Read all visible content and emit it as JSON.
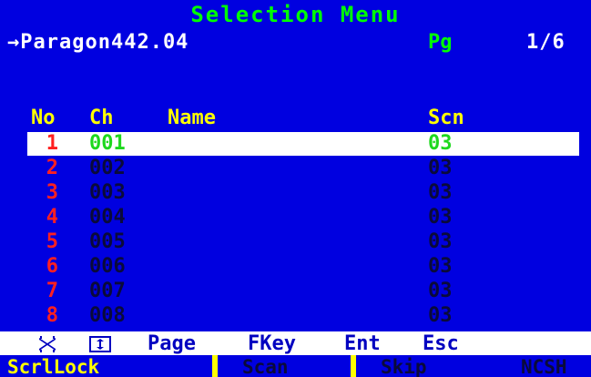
{
  "title": "Selection Menu",
  "current_path": "→Paragon442.04",
  "page": {
    "label": "Pg",
    "value": "1/6"
  },
  "headers": {
    "no": "No",
    "ch": "Ch",
    "name": "Name",
    "scn": "Scn"
  },
  "rows": [
    {
      "no": "1",
      "ch": "001",
      "name": "",
      "scn": "03",
      "selected": true
    },
    {
      "no": "2",
      "ch": "002",
      "name": "",
      "scn": "03"
    },
    {
      "no": "3",
      "ch": "003",
      "name": "",
      "scn": "03"
    },
    {
      "no": "4",
      "ch": "004",
      "name": "",
      "scn": "03"
    },
    {
      "no": "5",
      "ch": "005",
      "name": "",
      "scn": "03"
    },
    {
      "no": "6",
      "ch": "006",
      "name": "",
      "scn": "03"
    },
    {
      "no": "7",
      "ch": "007",
      "name": "",
      "scn": "03"
    },
    {
      "no": "8",
      "ch": "008",
      "name": "",
      "scn": "03"
    }
  ],
  "keybar": {
    "page": "Page",
    "fkey": "FKey",
    "ent": "Ent",
    "esc": "Esc"
  },
  "status": {
    "scrllock": "ScrlLock",
    "scan": "Scan",
    "skip": "Skip",
    "ncsh": "NCSH"
  },
  "colors": {
    "background": "#0000e0",
    "title": "#00ff00",
    "header": "#ffff00",
    "row_number": "#ff2020",
    "row_text": "#0a0a3a",
    "selected_text": "#1ed81e",
    "selected_background": "#ffffff",
    "keybar_text": "#0000c0"
  },
  "icons": {
    "updown_arrows": "updown-arrows-icon",
    "updown_box": "updown-box-icon"
  }
}
